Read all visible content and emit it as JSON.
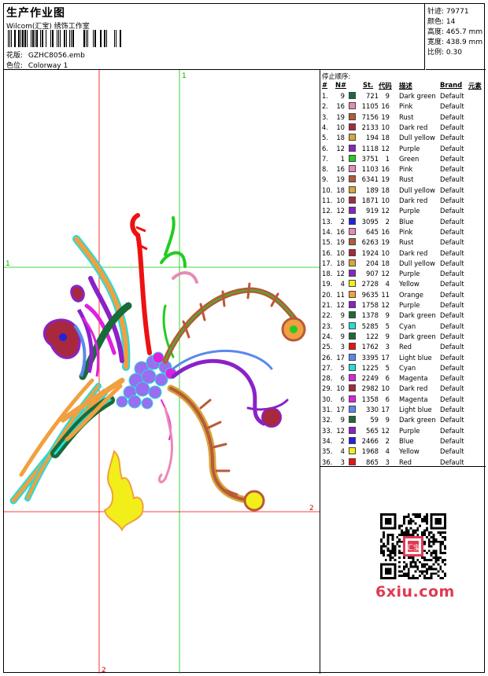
{
  "header": {
    "title": "生产作业图",
    "company": "Wilcom(汇宝) 绣饰工作室",
    "design_label": "花版:",
    "design_value": "GZHC8056.emb",
    "colorway_label": "色位:",
    "colorway_value": "Colorway 1"
  },
  "stats": {
    "stitches_label": "针迹:",
    "stitches_value": "79771",
    "colors_label": "颜色:",
    "colors_value": "14",
    "height_label": "高度:",
    "height_value": "465.7 mm",
    "width_label": "宽度:",
    "width_value": "438.9 mm",
    "scale_label": "比例:",
    "scale_value": "0.30"
  },
  "guides": {
    "v1_label": "1",
    "h1_label": "1",
    "h2_label": "2",
    "v2_label": "2",
    "v1_color": "#00cc00",
    "v2_color": "#ff0000"
  },
  "stop_sequence": {
    "title": "停止顺序:",
    "headers": [
      "#",
      "N#",
      "St.",
      "代码",
      "描述",
      "Brand",
      "元素"
    ],
    "rows": [
      {
        "idx": "1.",
        "n": "9",
        "st": "721",
        "code": "9",
        "desc": "Dark green",
        "brand": "Default",
        "color": "#1a6b3a"
      },
      {
        "idx": "2.",
        "n": "16",
        "st": "1105",
        "code": "16",
        "desc": "Pink",
        "brand": "Default",
        "color": "#e88ab6"
      },
      {
        "idx": "3.",
        "n": "19",
        "st": "7156",
        "code": "19",
        "desc": "Rust",
        "brand": "Default",
        "color": "#b75a3a"
      },
      {
        "idx": "4.",
        "n": "10",
        "st": "2133",
        "code": "10",
        "desc": "Dark red",
        "brand": "Default",
        "color": "#a8283e"
      },
      {
        "idx": "5.",
        "n": "18",
        "st": "194",
        "code": "18",
        "desc": "Dull yellow",
        "brand": "Default",
        "color": "#d8a63a"
      },
      {
        "idx": "6.",
        "n": "12",
        "st": "1118",
        "code": "12",
        "desc": "Purple",
        "brand": "Default",
        "color": "#8a22c8"
      },
      {
        "idx": "7.",
        "n": "1",
        "st": "3751",
        "code": "1",
        "desc": "Green",
        "brand": "Default",
        "color": "#22cc22"
      },
      {
        "idx": "8.",
        "n": "16",
        "st": "1103",
        "code": "16",
        "desc": "Pink",
        "brand": "Default",
        "color": "#e88ab6"
      },
      {
        "idx": "9.",
        "n": "19",
        "st": "6341",
        "code": "19",
        "desc": "Rust",
        "brand": "Default",
        "color": "#b75a3a"
      },
      {
        "idx": "10.",
        "n": "18",
        "st": "189",
        "code": "18",
        "desc": "Dull yellow",
        "brand": "Default",
        "color": "#d8a63a"
      },
      {
        "idx": "11.",
        "n": "10",
        "st": "1871",
        "code": "10",
        "desc": "Dark red",
        "brand": "Default",
        "color": "#a8283e"
      },
      {
        "idx": "12.",
        "n": "12",
        "st": "919",
        "code": "12",
        "desc": "Purple",
        "brand": "Default",
        "color": "#8a22c8"
      },
      {
        "idx": "13.",
        "n": "2",
        "st": "3095",
        "code": "2",
        "desc": "Blue",
        "brand": "Default",
        "color": "#2222dd"
      },
      {
        "idx": "14.",
        "n": "16",
        "st": "645",
        "code": "16",
        "desc": "Pink",
        "brand": "Default",
        "color": "#e88ab6"
      },
      {
        "idx": "15.",
        "n": "19",
        "st": "6263",
        "code": "19",
        "desc": "Rust",
        "brand": "Default",
        "color": "#b75a3a"
      },
      {
        "idx": "16.",
        "n": "10",
        "st": "1924",
        "code": "10",
        "desc": "Dark red",
        "brand": "Default",
        "color": "#a8283e"
      },
      {
        "idx": "17.",
        "n": "18",
        "st": "204",
        "code": "18",
        "desc": "Dull yellow",
        "brand": "Default",
        "color": "#d8a63a"
      },
      {
        "idx": "18.",
        "n": "12",
        "st": "907",
        "code": "12",
        "desc": "Purple",
        "brand": "Default",
        "color": "#8a22c8"
      },
      {
        "idx": "19.",
        "n": "4",
        "st": "2728",
        "code": "4",
        "desc": "Yellow",
        "brand": "Default",
        "color": "#f2ee1a"
      },
      {
        "idx": "20.",
        "n": "11",
        "st": "9635",
        "code": "11",
        "desc": "Orange",
        "brand": "Default",
        "color": "#f0a040"
      },
      {
        "idx": "21.",
        "n": "12",
        "st": "1758",
        "code": "12",
        "desc": "Purple",
        "brand": "Default",
        "color": "#8a22c8"
      },
      {
        "idx": "22.",
        "n": "9",
        "st": "1378",
        "code": "9",
        "desc": "Dark green",
        "brand": "Default",
        "color": "#1a6b3a"
      },
      {
        "idx": "23.",
        "n": "5",
        "st": "5285",
        "code": "5",
        "desc": "Cyan",
        "brand": "Default",
        "color": "#22dddd"
      },
      {
        "idx": "24.",
        "n": "9",
        "st": "122",
        "code": "9",
        "desc": "Dark green",
        "brand": "Default",
        "color": "#1a6b3a"
      },
      {
        "idx": "25.",
        "n": "3",
        "st": "1762",
        "code": "3",
        "desc": "Red",
        "brand": "Default",
        "color": "#ee1111"
      },
      {
        "idx": "26.",
        "n": "17",
        "st": "3395",
        "code": "17",
        "desc": "Light blue",
        "brand": "Default",
        "color": "#5a88ee"
      },
      {
        "idx": "27.",
        "n": "5",
        "st": "1225",
        "code": "5",
        "desc": "Cyan",
        "brand": "Default",
        "color": "#22dddd"
      },
      {
        "idx": "28.",
        "n": "6",
        "st": "2249",
        "code": "6",
        "desc": "Magenta",
        "brand": "Default",
        "color": "#e020e0"
      },
      {
        "idx": "29.",
        "n": "10",
        "st": "2982",
        "code": "10",
        "desc": "Dark red",
        "brand": "Default",
        "color": "#a8283e"
      },
      {
        "idx": "30.",
        "n": "6",
        "st": "1358",
        "code": "6",
        "desc": "Magenta",
        "brand": "Default",
        "color": "#e020e0"
      },
      {
        "idx": "31.",
        "n": "17",
        "st": "330",
        "code": "17",
        "desc": "Light blue",
        "brand": "Default",
        "color": "#5a88ee"
      },
      {
        "idx": "32.",
        "n": "9",
        "st": "59",
        "code": "9",
        "desc": "Dark green",
        "brand": "Default",
        "color": "#1a6b3a"
      },
      {
        "idx": "33.",
        "n": "12",
        "st": "565",
        "code": "12",
        "desc": "Purple",
        "brand": "Default",
        "color": "#8a22c8"
      },
      {
        "idx": "34.",
        "n": "2",
        "st": "2466",
        "code": "2",
        "desc": "Blue",
        "brand": "Default",
        "color": "#2222dd"
      },
      {
        "idx": "35.",
        "n": "4",
        "st": "1968",
        "code": "4",
        "desc": "Yellow",
        "brand": "Default",
        "color": "#f2ee1a"
      },
      {
        "idx": "36.",
        "n": "3",
        "st": "865",
        "code": "3",
        "desc": "Red",
        "brand": "Default",
        "color": "#ee1111"
      }
    ]
  },
  "watermark": "6xiu.com",
  "qr_seal_text": "汇宝"
}
